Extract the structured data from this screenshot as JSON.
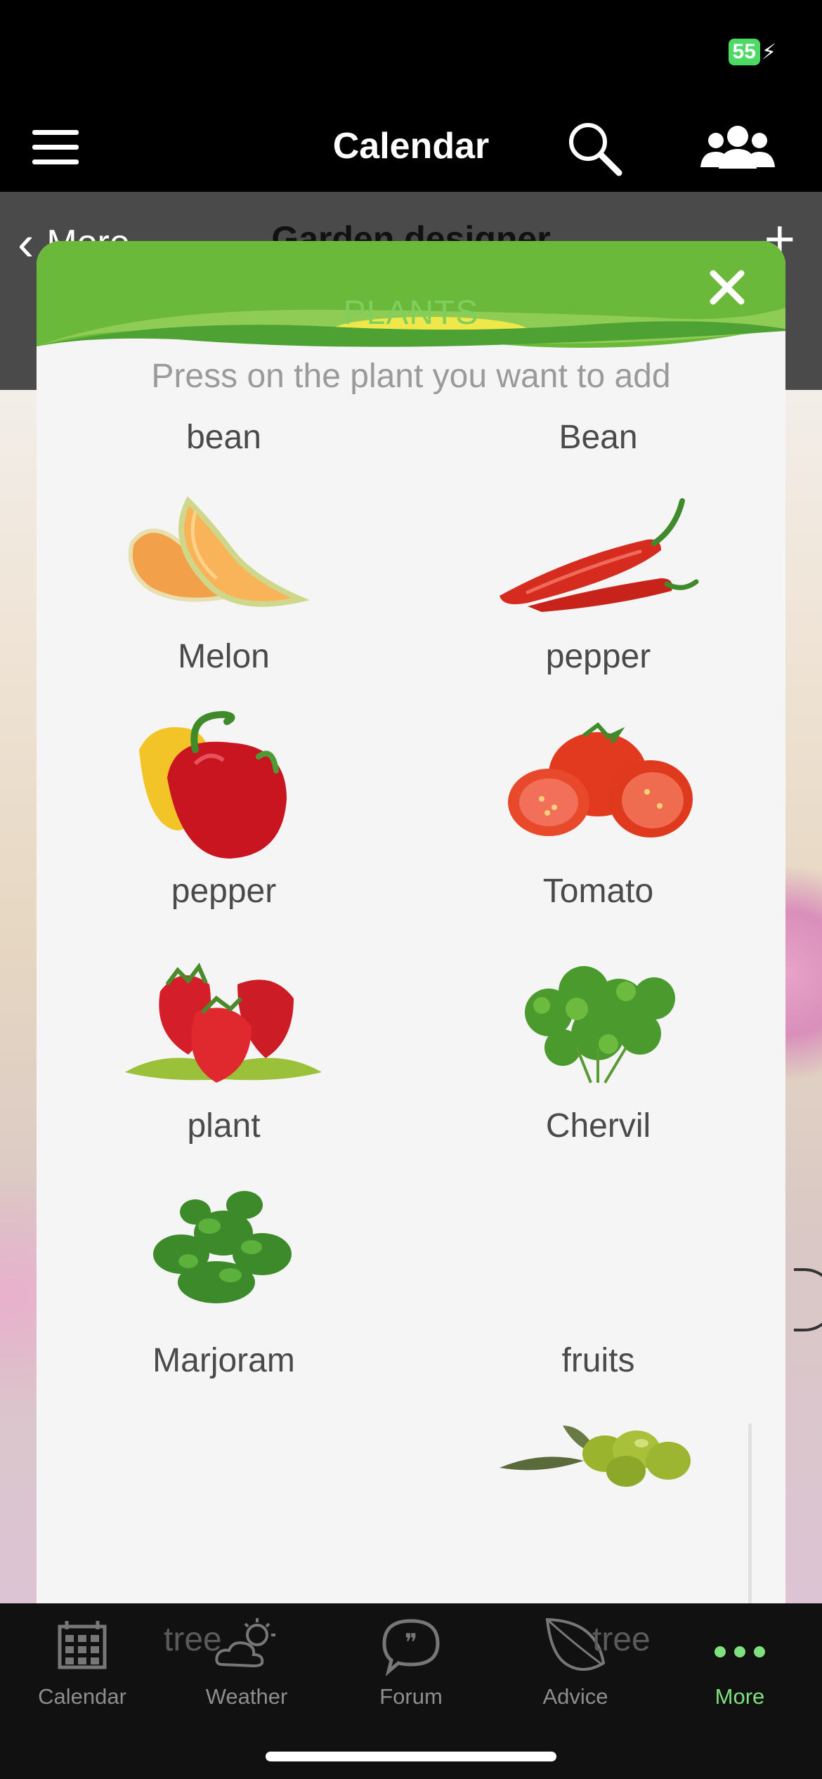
{
  "status_bar": {
    "battery": "55"
  },
  "top_bar": {
    "title": "Calendar"
  },
  "sub_bar": {
    "back_label": "More",
    "title": "Garden designer",
    "add_label": "+"
  },
  "modal": {
    "title": "PLANTS",
    "instruction": "Press on the plant you want to add",
    "plants": [
      {
        "label": "bean"
      },
      {
        "label": "Bean"
      },
      {
        "label": "Melon",
        "icon": "melon-image"
      },
      {
        "label": "pepper",
        "icon": "chili-pepper-image"
      },
      {
        "label": "pepper",
        "icon": "bell-pepper-image"
      },
      {
        "label": "Tomato",
        "icon": "tomato-image"
      },
      {
        "label": "plant",
        "icon": "strawberry-image"
      },
      {
        "label": "Chervil",
        "icon": "chervil-image"
      },
      {
        "label": "Marjoram",
        "icon": "marjoram-image"
      },
      {
        "label": "fruits"
      },
      {
        "label": "tree"
      },
      {
        "label": "tree",
        "icon": "olive-image"
      }
    ]
  },
  "tab_bar": {
    "items": [
      {
        "label": "Calendar",
        "icon": "calendar-grid-icon"
      },
      {
        "label": "Weather",
        "icon": "cloud-sun-icon"
      },
      {
        "label": "Forum",
        "icon": "chat-bubble-icon"
      },
      {
        "label": "Advice",
        "icon": "leaf-icon"
      },
      {
        "label": "More",
        "icon": "dots-icon"
      }
    ],
    "active": "More"
  },
  "colors": {
    "accent_green": "#7fcf5f",
    "active_tab": "#7ee07e",
    "header_green": "#6ab93a"
  }
}
